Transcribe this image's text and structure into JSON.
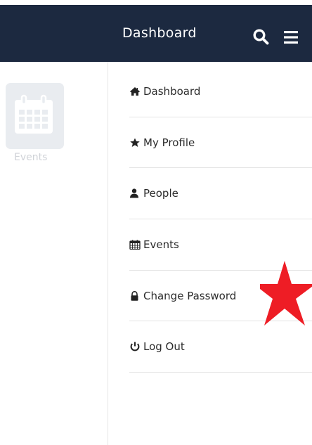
{
  "header": {
    "title": "Dashboard",
    "icons": {
      "search": "search-icon",
      "menu": "hamburger-menu-icon"
    }
  },
  "left_panel": {
    "tile": {
      "label": "Events",
      "icon": "calendar-icon"
    }
  },
  "menu": {
    "items": [
      {
        "label": "Dashboard",
        "icon": "home-icon"
      },
      {
        "label": "My Profile",
        "icon": "star-icon"
      },
      {
        "label": "People",
        "icon": "user-icon"
      },
      {
        "label": "Events",
        "icon": "calendar-icon"
      },
      {
        "label": "Change Password",
        "icon": "lock-icon"
      },
      {
        "label": "Log Out",
        "icon": "power-icon"
      }
    ]
  },
  "colors": {
    "header_bg": "#1c2940",
    "star_marker": "#ee1d25",
    "tile_bg": "#e9ecf0"
  }
}
